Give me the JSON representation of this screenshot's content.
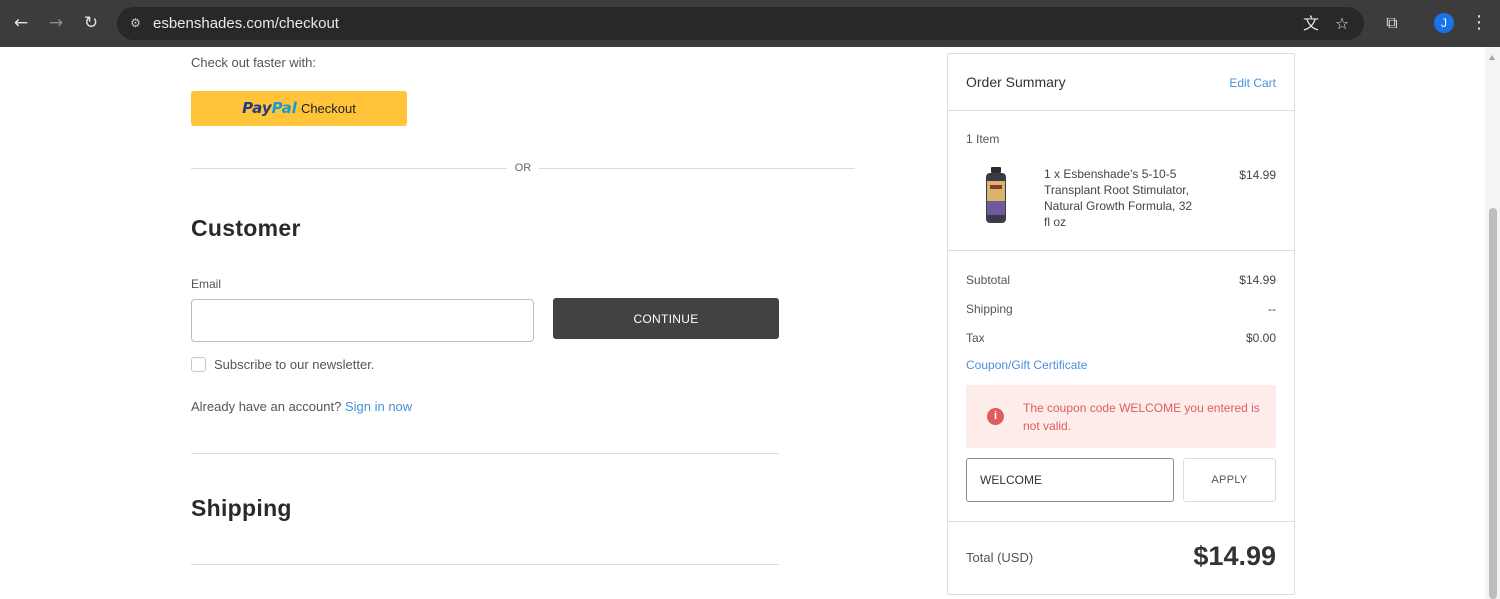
{
  "browser": {
    "url": "esbenshades.com/checkout",
    "avatar_letter": "J",
    "icons": {
      "back": "back-arrow-icon",
      "forward": "forward-arrow-icon",
      "reload": "reload-icon",
      "site_info": "tune-icon",
      "translate": "translate-icon",
      "bookmark": "star-icon",
      "extensions": "puzzle-icon",
      "menu": "kebab-menu-icon"
    }
  },
  "checkout": {
    "faster_text": "Check out faster with:",
    "paypal": {
      "pay": "Pay",
      "pal": "Pal",
      "label": "Checkout"
    },
    "or_text": "OR",
    "customer": {
      "heading": "Customer",
      "email_label": "Email",
      "email_value": "",
      "continue_label": "CONTINUE",
      "newsletter_label": "Subscribe to our newsletter.",
      "account_prompt": "Already have an account?",
      "signin_label": "Sign in now"
    },
    "shipping_heading": "Shipping"
  },
  "summary": {
    "title": "Order Summary",
    "edit_cart": "Edit Cart",
    "item_count": "1 Item",
    "item": {
      "name": "1 x Esbenshade's 5-10-5 Transplant Root Stimulator, Natural Growth Formula, 32 fl oz",
      "price": "$14.99"
    },
    "rows": [
      {
        "label": "Subtotal",
        "value": "$14.99"
      },
      {
        "label": "Shipping",
        "value": "--"
      },
      {
        "label": "Tax",
        "value": "$0.00"
      }
    ],
    "coupon_link": "Coupon/Gift Certificate",
    "alert_text": "The coupon code WELCOME you entered is not valid.",
    "coupon_value": "WELCOME",
    "apply_label": "APPLY",
    "total_label": "Total (USD)",
    "total_value": "$14.99"
  },
  "colors": {
    "paypal_yellow": "#ffc439",
    "link_blue": "#4a90d9",
    "error_red": "#e05d5d",
    "error_bg": "#fdecea",
    "button_dark": "#424242"
  }
}
